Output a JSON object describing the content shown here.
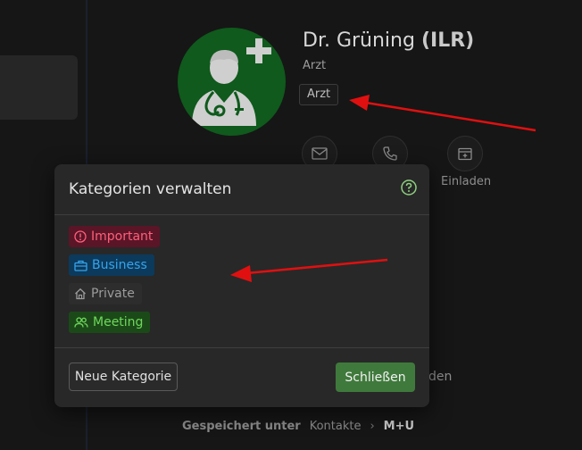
{
  "contact": {
    "name": "Dr. Grüning",
    "name_suffix": "(ILR)",
    "role": "Arzt",
    "tag": "Arzt"
  },
  "actions": [
    {
      "icon": "mail-icon",
      "label": ""
    },
    {
      "icon": "phone-icon",
      "label": ""
    },
    {
      "icon": "calendar-icon",
      "label": "Einladen"
    }
  ],
  "partial_text": "den",
  "breadcrumb": {
    "label": "Gespeichert unter",
    "items": [
      "Kontakte",
      "M+U"
    ]
  },
  "modal": {
    "title": "Kategorien verwalten",
    "categories": [
      {
        "label": "Important",
        "icon": "alert-circle-icon",
        "color": "#ff5f7a"
      },
      {
        "label": "Business",
        "icon": "briefcase-icon",
        "color": "#35a4ec"
      },
      {
        "label": "Private",
        "icon": "home-icon",
        "color": "#9c9c9c"
      },
      {
        "label": "Meeting",
        "icon": "people-icon",
        "color": "#6fd75c"
      }
    ],
    "new_button": "Neue Kategorie",
    "close_button": "Schließen"
  },
  "colors": {
    "avatar_bg": "#0f5a1c",
    "primary_green": "#3f7a3c",
    "annotation_arrow": "#e01010"
  }
}
